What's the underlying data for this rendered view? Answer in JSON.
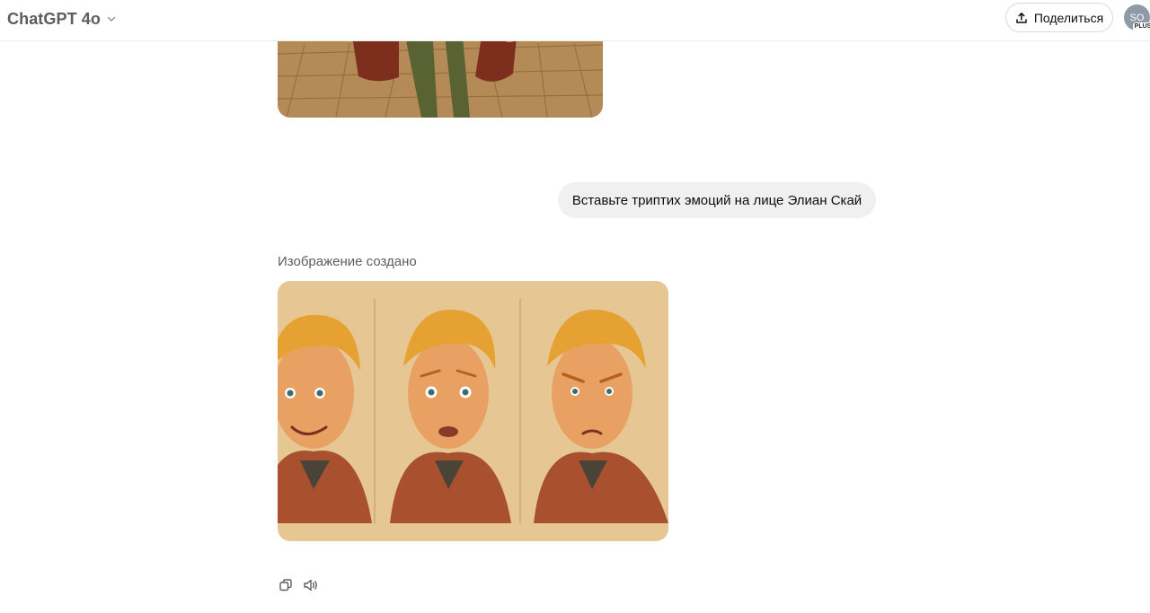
{
  "header": {
    "model_name": "ChatGPT 4o",
    "share_label": "Поделиться",
    "avatar_initials": "SO",
    "plan_badge": "PLUS"
  },
  "conversation": {
    "user_message": "Вставьте триптих эмоций на лице Элиан Скай",
    "image_status": "Изображение создано"
  },
  "colors": {
    "accent_text": "#0d0d0d",
    "muted_text": "#5d5d5d",
    "bubble_bg": "#f0f0f0",
    "image_bg": "#e6c692"
  }
}
